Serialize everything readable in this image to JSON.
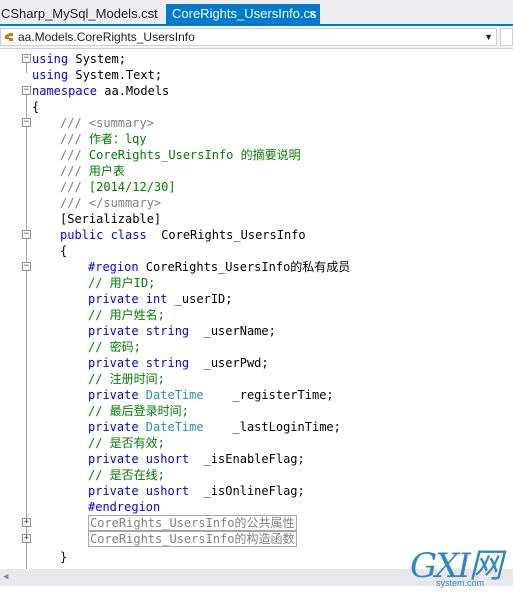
{
  "tabs": [
    {
      "label": "CSharp_MySql_Models.cst",
      "active": false
    },
    {
      "label": "CoreRights_UsersInfo.cs",
      "active": true
    }
  ],
  "tab_close_icon": "×",
  "navigation": {
    "class_dropdown": "aa.Models.CoreRights_UsersInfo",
    "dropdown_arrow": "▼"
  },
  "code": {
    "l1": {
      "kw": "using",
      "rest": " System;"
    },
    "l2": {
      "kw": "using",
      "rest": " System.Text;"
    },
    "l3": {
      "kw": "namespace",
      "rest": " aa.Models"
    },
    "l4": "{",
    "l5": {
      "a": "/// ",
      "b": "<summary>"
    },
    "l6": {
      "a": "/// ",
      "b": "作者：lqy"
    },
    "l7": {
      "a": "/// ",
      "b": "CoreRights_UsersInfo 的摘要说明"
    },
    "l8": {
      "a": "/// ",
      "b": "用户表"
    },
    "l9": {
      "a": "/// ",
      "b": "[2014/12/30]"
    },
    "l10": {
      "a": "/// ",
      "b": "</summary>"
    },
    "l11": "[Serializable]",
    "l12": {
      "kw": "public class",
      "rest": "  CoreRights_UsersInfo"
    },
    "l13": "{",
    "l14": {
      "kw": "#region",
      "rest": " CoreRights_UsersInfo的私有成员"
    },
    "l15": "// 用户ID;",
    "l16": {
      "kw": "private int",
      "rest": " _userID;"
    },
    "l17": "// 用户姓名;",
    "l18": {
      "kw": "private string",
      "rest": "  _userName;"
    },
    "l19": "// 密码;",
    "l20": {
      "kw": "private string",
      "rest": "  _userPwd;"
    },
    "l21": "// 注册时间;",
    "l22": {
      "kw": "private",
      "ty": " DateTime",
      "rest": "    _registerTime;"
    },
    "l23": "// 最后登录时间;",
    "l24": {
      "kw": "private",
      "ty": " DateTime",
      "rest": "    _lastLoginTime;"
    },
    "l25": "// 是否有效;",
    "l26": {
      "kw": "private ushort",
      "rest": "  _isEnableFlag;"
    },
    "l27": "// 是否在线;",
    "l28": {
      "kw": "private ushort",
      "rest": "  _isOnlineFlag;"
    },
    "l29": "#endregion",
    "l30": "CoreRights_UsersInfo的公共属性",
    "l31": "CoreRights_UsersInfo的构造函数",
    "l32": "}"
  },
  "watermark": {
    "big": "GXI网",
    "small": "system.com"
  },
  "colors": {
    "keyword": "#0000ff",
    "comment": "#008000",
    "doc_tag": "#808080",
    "type": "#2b91af",
    "tab_active": "#007acc"
  }
}
